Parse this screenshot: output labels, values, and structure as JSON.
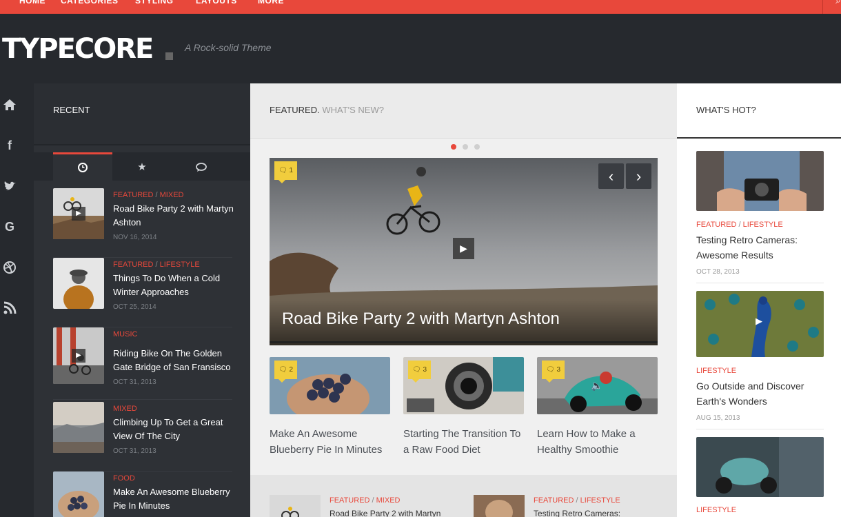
{
  "nav": {
    "items": [
      "HOME",
      "CATEGORIES",
      "STYLING",
      "LAYOUTS",
      "MORE"
    ]
  },
  "header": {
    "logo": "TYPECORE",
    "tagline": "A Rock-solid Theme"
  },
  "social": [
    "home-icon",
    "facebook-icon",
    "twitter-icon",
    "google-icon",
    "dribbble-icon",
    "rss-icon"
  ],
  "recent": {
    "title": "RECENT",
    "tabs": [
      "recent",
      "popular",
      "comments"
    ],
    "posts": [
      {
        "cat1": "FEATURED",
        "cat2": "MIXED",
        "title": "Road Bike Party 2 with Martyn Ashton",
        "date": "NOV 16, 2014"
      },
      {
        "cat1": "FEATURED",
        "cat2": "LIFESTYLE",
        "title": "Things To Do When a Cold Winter Approaches",
        "date": "OCT 25, 2014"
      },
      {
        "cat1": "MUSIC",
        "cat2": "",
        "title": "Riding Bike On The Golden Gate Bridge of San Fransisco",
        "date": "OCT 31, 2013"
      },
      {
        "cat1": "MIXED",
        "cat2": "",
        "title": "Climbing Up To Get a Great View Of The City",
        "date": "OCT 31, 2013"
      },
      {
        "cat1": "FOOD",
        "cat2": "",
        "title": "Make An Awesome Blueberry Pie In Minutes",
        "date": ""
      }
    ]
  },
  "featured": {
    "head_a": "FEATURED.",
    "head_b": "WHAT'S NEW?",
    "hero": {
      "title": "Road Bike Party 2 with Martyn Ashton",
      "comments": "1"
    },
    "cards": [
      {
        "title": "Make An Awesome Blueberry Pie In Minutes",
        "comments": "2"
      },
      {
        "title": "Starting The Transition To a Raw Food Diet",
        "comments": "3"
      },
      {
        "title": "Learn How to Make a Healthy Smoothie",
        "comments": "3"
      }
    ],
    "lower": [
      {
        "cat1": "FEATURED",
        "cat2": "MIXED",
        "title": "Road Bike Party 2 with Martyn"
      },
      {
        "cat1": "FEATURED",
        "cat2": "LIFESTYLE",
        "title": "Testing Retro Cameras:"
      }
    ]
  },
  "hot": {
    "title": "WHAT'S HOT?",
    "items": [
      {
        "cat1": "FEATURED",
        "cat2": "LIFESTYLE",
        "title": "Testing Retro Cameras: Awesome Results",
        "date": "OCT 28, 2013"
      },
      {
        "cat1": "LIFESTYLE",
        "cat2": "",
        "title": "Go Outside and Discover Earth's Wonders",
        "date": "AUG 15, 2013"
      },
      {
        "cat1": "LIFESTYLE",
        "cat2": "",
        "title": "",
        "date": ""
      }
    ]
  },
  "colors": {
    "accent": "#e8483b",
    "dark": "#26292e",
    "badge": "#f1cd3d"
  }
}
